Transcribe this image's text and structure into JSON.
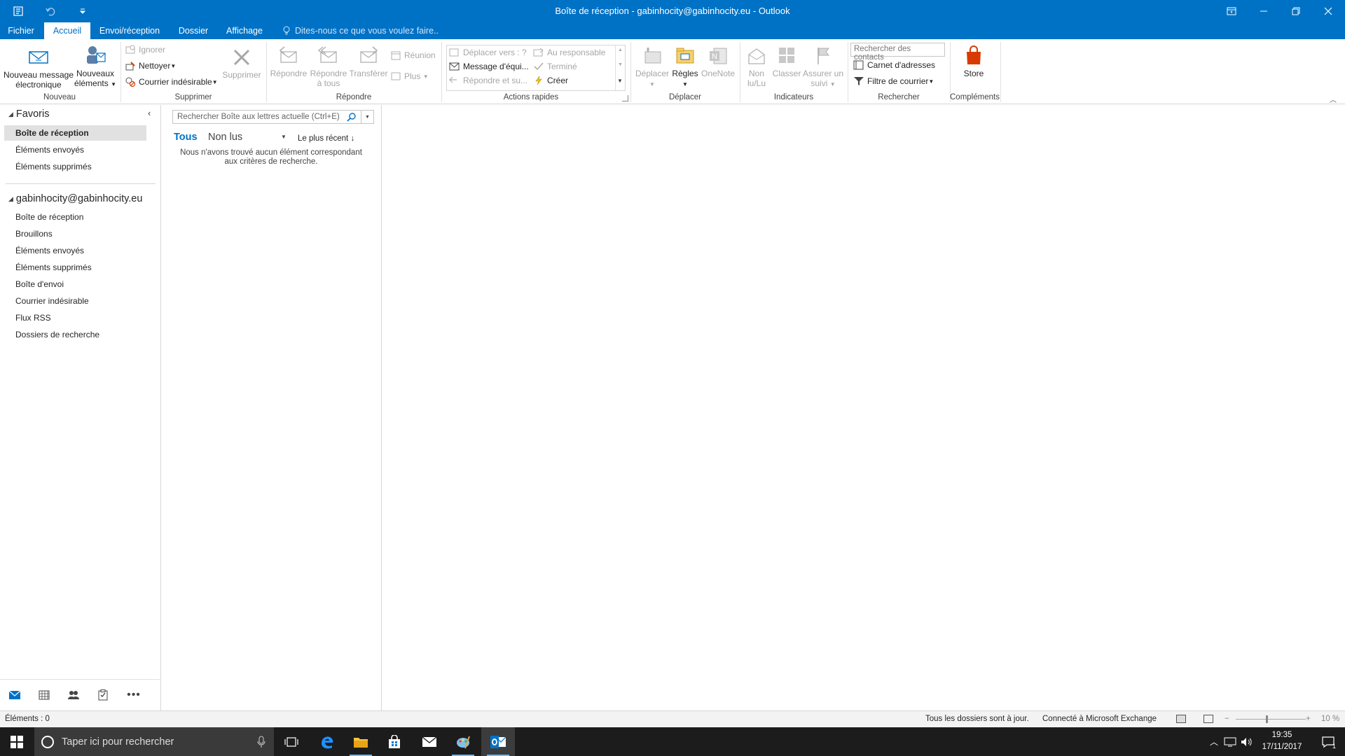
{
  "window": {
    "title": "Boîte de réception - gabinhocity@gabinhocity.eu - Outlook"
  },
  "tabs": [
    {
      "label": "Fichier"
    },
    {
      "label": "Accueil"
    },
    {
      "label": "Envoi/réception"
    },
    {
      "label": "Dossier"
    },
    {
      "label": "Affichage"
    }
  ],
  "tell_me": "Dites-nous ce que vous voulez faire..",
  "ribbon": {
    "nouveau": {
      "new_message_l1": "Nouveau message",
      "new_message_l2": "électronique",
      "new_items_l1": "Nouveaux",
      "new_items_l2": "éléments",
      "group": "Nouveau"
    },
    "supprimer": {
      "ignore": "Ignorer",
      "clean": "Nettoyer",
      "junk": "Courrier indésirable",
      "delete": "Supprimer",
      "group": "Supprimer"
    },
    "repondre": {
      "reply": "Répondre",
      "reply_all_l1": "Répondre",
      "reply_all_l2": "à tous",
      "forward": "Transférer",
      "meeting": "Réunion",
      "more": "Plus",
      "group": "Répondre"
    },
    "actions_rapides": {
      "move_to": "Déplacer vers : ?",
      "team_email": "Message d'équi...",
      "reply_delete": "Répondre et su...",
      "to_manager": "Au responsable",
      "done": "Terminé",
      "create": "Créer",
      "group": "Actions rapides"
    },
    "deplacer": {
      "move": "Déplacer",
      "rules": "Règles",
      "onenote": "OneNote",
      "group": "Déplacer"
    },
    "indicateurs": {
      "unread_l1": "Non",
      "unread_l2": "lu/Lu",
      "categorize": "Classer",
      "followup_l1": "Assurer un",
      "followup_l2": "suivi",
      "group": "Indicateurs"
    },
    "rechercher": {
      "search_people_placeholder": "Rechercher des contacts",
      "address_book": "Carnet d'adresses",
      "filter_email": "Filtre de courrier",
      "group": "Rechercher"
    },
    "complements": {
      "store": "Store",
      "group": "Compléments"
    }
  },
  "nav": {
    "favorites_header": "Favoris",
    "favorites": [
      {
        "label": "Boîte de réception"
      },
      {
        "label": "Éléments envoyés"
      },
      {
        "label": "Éléments supprimés"
      }
    ],
    "account_header": "gabinhocity@gabinhocity.eu",
    "folders": [
      {
        "label": "Boîte de réception"
      },
      {
        "label": "Brouillons"
      },
      {
        "label": "Éléments envoyés"
      },
      {
        "label": "Éléments supprimés"
      },
      {
        "label": "Boîte d'envoi"
      },
      {
        "label": "Courrier indésirable"
      },
      {
        "label": "Flux RSS"
      },
      {
        "label": "Dossiers de recherche"
      }
    ]
  },
  "message_list": {
    "search_placeholder": "Rechercher Boîte aux lettres actuelle (Ctrl+E)",
    "filter_all": "Tous",
    "filter_unread": "Non lus",
    "sort": "Le plus récent",
    "empty_l1": "Nous n'avons trouvé aucun élément correspondant",
    "empty_l2": "aux critères de recherche."
  },
  "status_bar": {
    "items": "Éléments : 0",
    "sync": "Tous les dossiers sont à jour.",
    "connection": "Connecté à Microsoft Exchange",
    "zoom": "10 %"
  },
  "taskbar": {
    "search_placeholder": "Taper ici pour rechercher",
    "time": "19:35",
    "date": "17/11/2017",
    "notification_count": "1"
  },
  "colors": {
    "accent": "#0072c6",
    "office_red": "#d83b01"
  }
}
